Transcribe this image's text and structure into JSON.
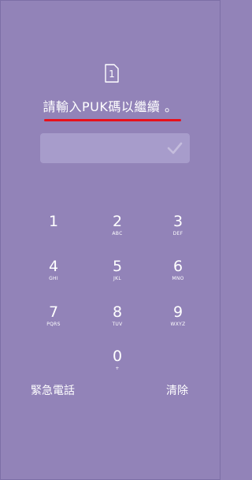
{
  "sim": {
    "slot": "1"
  },
  "prompt": {
    "text": "請輸入PUK碼以繼續 。"
  },
  "pin_field": {
    "value": ""
  },
  "keypad": {
    "keys": [
      {
        "num": "1",
        "letters": ""
      },
      {
        "num": "2",
        "letters": "ABC"
      },
      {
        "num": "3",
        "letters": "DEF"
      },
      {
        "num": "4",
        "letters": "GHI"
      },
      {
        "num": "5",
        "letters": "JKL"
      },
      {
        "num": "6",
        "letters": "MNO"
      },
      {
        "num": "7",
        "letters": "PQRS"
      },
      {
        "num": "8",
        "letters": "TUV"
      },
      {
        "num": "9",
        "letters": "WXYZ"
      },
      {
        "num": "0",
        "letters": "+"
      }
    ]
  },
  "actions": {
    "emergency_label": "緊急電話",
    "clear_label": "清除"
  },
  "colors": {
    "background": "#9283b8",
    "field": "#a79ccb",
    "underline": "#e8101b"
  }
}
